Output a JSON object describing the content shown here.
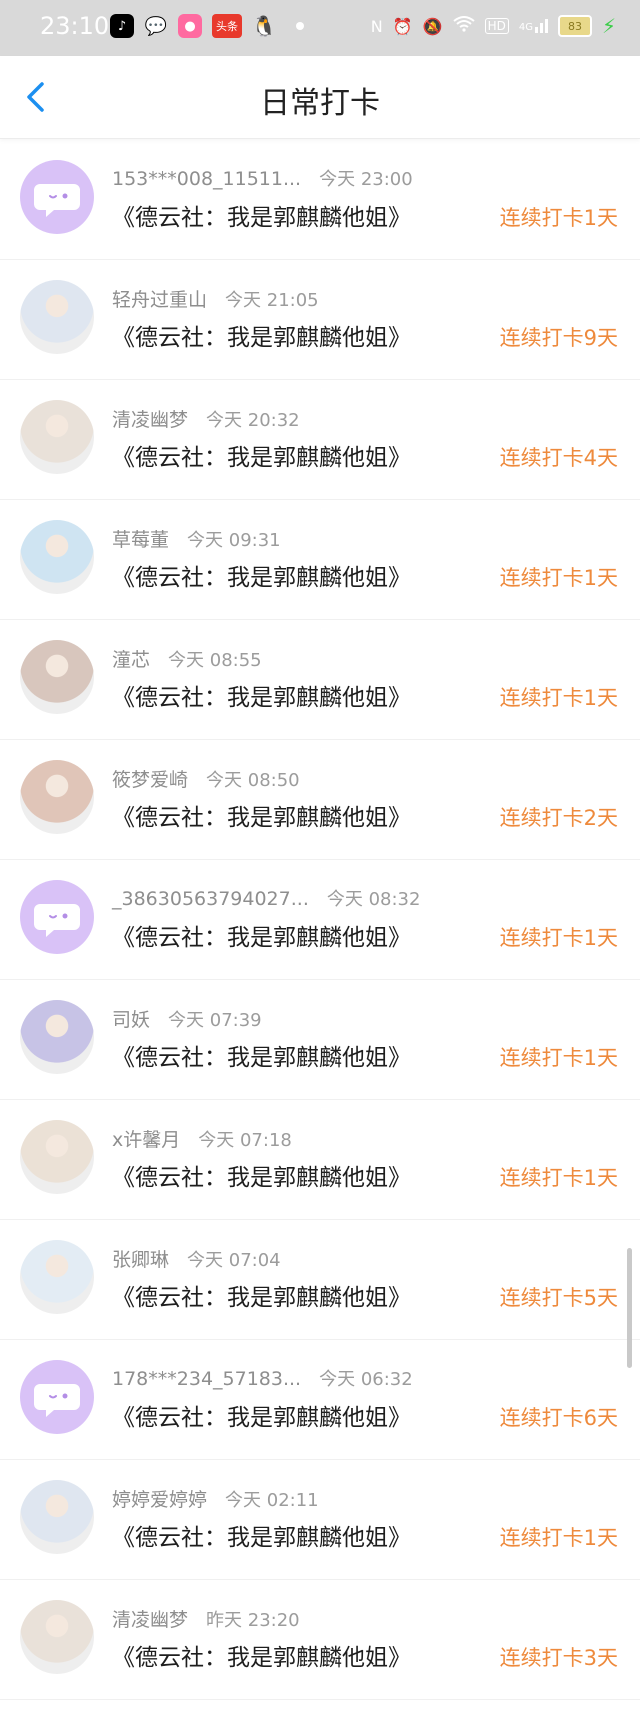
{
  "status_bar": {
    "time": "23:10",
    "toutiao_label": "头条",
    "hd_label": "HD",
    "signal_label": "4G",
    "battery": "83"
  },
  "header": {
    "title": "日常打卡"
  },
  "items": [
    {
      "name": "153***008_11511...",
      "time": "今天 23:00",
      "book": "《德云社：我是郭麒麟他姐》",
      "streak": "连续打卡1天",
      "avatar": "default"
    },
    {
      "name": "轻舟过重山",
      "time": "今天 21:05",
      "book": "《德云社：我是郭麒麟他姐》",
      "streak": "连续打卡9天",
      "avatar": "photo"
    },
    {
      "name": "清凌幽梦",
      "time": "今天 20:32",
      "book": "《德云社：我是郭麒麟他姐》",
      "streak": "连续打卡4天",
      "avatar": "photo"
    },
    {
      "name": "草莓董",
      "time": "今天 09:31",
      "book": "《德云社：我是郭麒麟他姐》",
      "streak": "连续打卡1天",
      "avatar": "photo"
    },
    {
      "name": "潼芯",
      "time": "今天 08:55",
      "book": "《德云社：我是郭麒麟他姐》",
      "streak": "连续打卡1天",
      "avatar": "photo"
    },
    {
      "name": "筱梦爱崎",
      "time": "今天 08:50",
      "book": "《德云社：我是郭麒麟他姐》",
      "streak": "连续打卡2天",
      "avatar": "photo"
    },
    {
      "name": "_38630563794027...",
      "time": "今天 08:32",
      "book": "《德云社：我是郭麒麟他姐》",
      "streak": "连续打卡1天",
      "avatar": "default"
    },
    {
      "name": "司妖",
      "time": "今天 07:39",
      "book": "《德云社：我是郭麒麟他姐》",
      "streak": "连续打卡1天",
      "avatar": "photo"
    },
    {
      "name": "x许馨月",
      "time": "今天 07:18",
      "book": "《德云社：我是郭麒麟他姐》",
      "streak": "连续打卡1天",
      "avatar": "photo"
    },
    {
      "name": "张卿琳",
      "time": "今天 07:04",
      "book": "《德云社：我是郭麒麟他姐》",
      "streak": "连续打卡5天",
      "avatar": "photo"
    },
    {
      "name": "178***234_57183...",
      "time": "今天 06:32",
      "book": "《德云社：我是郭麒麟他姐》",
      "streak": "连续打卡6天",
      "avatar": "default"
    },
    {
      "name": "婷婷爱婷婷",
      "time": "今天 02:11",
      "book": "《德云社：我是郭麒麟他姐》",
      "streak": "连续打卡1天",
      "avatar": "photo"
    },
    {
      "name": "清凌幽梦",
      "time": "昨天 23:20",
      "book": "《德云社：我是郭麒麟他姐》",
      "streak": "连续打卡3天",
      "avatar": "photo"
    }
  ],
  "colors": {
    "accent_orange": "#ee8a3c",
    "back_blue": "#1c8ff0",
    "default_avatar_bg": "#d9c2f7",
    "photo_avatar_palette": [
      "#6f6f6f",
      "#dfe6f0",
      "#e9e1d9",
      "#cfe4f2",
      "#d8c6bd",
      "#e0c5b8",
      "#4d5a4f",
      "#c7c3e6",
      "#ebe1d6",
      "#e3ecf4"
    ]
  }
}
